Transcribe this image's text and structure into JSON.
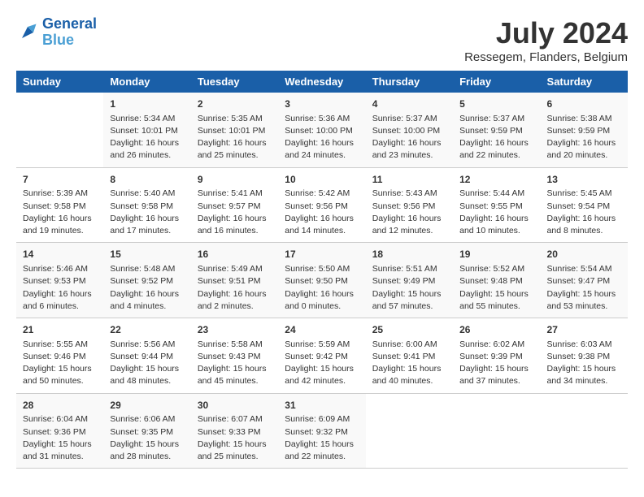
{
  "logo": {
    "line1": "General",
    "line2": "Blue"
  },
  "title": "July 2024",
  "location": "Ressegem, Flanders, Belgium",
  "days_header": [
    "Sunday",
    "Monday",
    "Tuesday",
    "Wednesday",
    "Thursday",
    "Friday",
    "Saturday"
  ],
  "weeks": [
    [
      {
        "day": "",
        "sunrise": "",
        "sunset": "",
        "daylight": ""
      },
      {
        "day": "1",
        "sunrise": "Sunrise: 5:34 AM",
        "sunset": "Sunset: 10:01 PM",
        "daylight": "Daylight: 16 hours and 26 minutes."
      },
      {
        "day": "2",
        "sunrise": "Sunrise: 5:35 AM",
        "sunset": "Sunset: 10:01 PM",
        "daylight": "Daylight: 16 hours and 25 minutes."
      },
      {
        "day": "3",
        "sunrise": "Sunrise: 5:36 AM",
        "sunset": "Sunset: 10:00 PM",
        "daylight": "Daylight: 16 hours and 24 minutes."
      },
      {
        "day": "4",
        "sunrise": "Sunrise: 5:37 AM",
        "sunset": "Sunset: 10:00 PM",
        "daylight": "Daylight: 16 hours and 23 minutes."
      },
      {
        "day": "5",
        "sunrise": "Sunrise: 5:37 AM",
        "sunset": "Sunset: 9:59 PM",
        "daylight": "Daylight: 16 hours and 22 minutes."
      },
      {
        "day": "6",
        "sunrise": "Sunrise: 5:38 AM",
        "sunset": "Sunset: 9:59 PM",
        "daylight": "Daylight: 16 hours and 20 minutes."
      }
    ],
    [
      {
        "day": "7",
        "sunrise": "Sunrise: 5:39 AM",
        "sunset": "Sunset: 9:58 PM",
        "daylight": "Daylight: 16 hours and 19 minutes."
      },
      {
        "day": "8",
        "sunrise": "Sunrise: 5:40 AM",
        "sunset": "Sunset: 9:58 PM",
        "daylight": "Daylight: 16 hours and 17 minutes."
      },
      {
        "day": "9",
        "sunrise": "Sunrise: 5:41 AM",
        "sunset": "Sunset: 9:57 PM",
        "daylight": "Daylight: 16 hours and 16 minutes."
      },
      {
        "day": "10",
        "sunrise": "Sunrise: 5:42 AM",
        "sunset": "Sunset: 9:56 PM",
        "daylight": "Daylight: 16 hours and 14 minutes."
      },
      {
        "day": "11",
        "sunrise": "Sunrise: 5:43 AM",
        "sunset": "Sunset: 9:56 PM",
        "daylight": "Daylight: 16 hours and 12 minutes."
      },
      {
        "day": "12",
        "sunrise": "Sunrise: 5:44 AM",
        "sunset": "Sunset: 9:55 PM",
        "daylight": "Daylight: 16 hours and 10 minutes."
      },
      {
        "day": "13",
        "sunrise": "Sunrise: 5:45 AM",
        "sunset": "Sunset: 9:54 PM",
        "daylight": "Daylight: 16 hours and 8 minutes."
      }
    ],
    [
      {
        "day": "14",
        "sunrise": "Sunrise: 5:46 AM",
        "sunset": "Sunset: 9:53 PM",
        "daylight": "Daylight: 16 hours and 6 minutes."
      },
      {
        "day": "15",
        "sunrise": "Sunrise: 5:48 AM",
        "sunset": "Sunset: 9:52 PM",
        "daylight": "Daylight: 16 hours and 4 minutes."
      },
      {
        "day": "16",
        "sunrise": "Sunrise: 5:49 AM",
        "sunset": "Sunset: 9:51 PM",
        "daylight": "Daylight: 16 hours and 2 minutes."
      },
      {
        "day": "17",
        "sunrise": "Sunrise: 5:50 AM",
        "sunset": "Sunset: 9:50 PM",
        "daylight": "Daylight: 16 hours and 0 minutes."
      },
      {
        "day": "18",
        "sunrise": "Sunrise: 5:51 AM",
        "sunset": "Sunset: 9:49 PM",
        "daylight": "Daylight: 15 hours and 57 minutes."
      },
      {
        "day": "19",
        "sunrise": "Sunrise: 5:52 AM",
        "sunset": "Sunset: 9:48 PM",
        "daylight": "Daylight: 15 hours and 55 minutes."
      },
      {
        "day": "20",
        "sunrise": "Sunrise: 5:54 AM",
        "sunset": "Sunset: 9:47 PM",
        "daylight": "Daylight: 15 hours and 53 minutes."
      }
    ],
    [
      {
        "day": "21",
        "sunrise": "Sunrise: 5:55 AM",
        "sunset": "Sunset: 9:46 PM",
        "daylight": "Daylight: 15 hours and 50 minutes."
      },
      {
        "day": "22",
        "sunrise": "Sunrise: 5:56 AM",
        "sunset": "Sunset: 9:44 PM",
        "daylight": "Daylight: 15 hours and 48 minutes."
      },
      {
        "day": "23",
        "sunrise": "Sunrise: 5:58 AM",
        "sunset": "Sunset: 9:43 PM",
        "daylight": "Daylight: 15 hours and 45 minutes."
      },
      {
        "day": "24",
        "sunrise": "Sunrise: 5:59 AM",
        "sunset": "Sunset: 9:42 PM",
        "daylight": "Daylight: 15 hours and 42 minutes."
      },
      {
        "day": "25",
        "sunrise": "Sunrise: 6:00 AM",
        "sunset": "Sunset: 9:41 PM",
        "daylight": "Daylight: 15 hours and 40 minutes."
      },
      {
        "day": "26",
        "sunrise": "Sunrise: 6:02 AM",
        "sunset": "Sunset: 9:39 PM",
        "daylight": "Daylight: 15 hours and 37 minutes."
      },
      {
        "day": "27",
        "sunrise": "Sunrise: 6:03 AM",
        "sunset": "Sunset: 9:38 PM",
        "daylight": "Daylight: 15 hours and 34 minutes."
      }
    ],
    [
      {
        "day": "28",
        "sunrise": "Sunrise: 6:04 AM",
        "sunset": "Sunset: 9:36 PM",
        "daylight": "Daylight: 15 hours and 31 minutes."
      },
      {
        "day": "29",
        "sunrise": "Sunrise: 6:06 AM",
        "sunset": "Sunset: 9:35 PM",
        "daylight": "Daylight: 15 hours and 28 minutes."
      },
      {
        "day": "30",
        "sunrise": "Sunrise: 6:07 AM",
        "sunset": "Sunset: 9:33 PM",
        "daylight": "Daylight: 15 hours and 25 minutes."
      },
      {
        "day": "31",
        "sunrise": "Sunrise: 6:09 AM",
        "sunset": "Sunset: 9:32 PM",
        "daylight": "Daylight: 15 hours and 22 minutes."
      },
      {
        "day": "",
        "sunrise": "",
        "sunset": "",
        "daylight": ""
      },
      {
        "day": "",
        "sunrise": "",
        "sunset": "",
        "daylight": ""
      },
      {
        "day": "",
        "sunrise": "",
        "sunset": "",
        "daylight": ""
      }
    ]
  ]
}
